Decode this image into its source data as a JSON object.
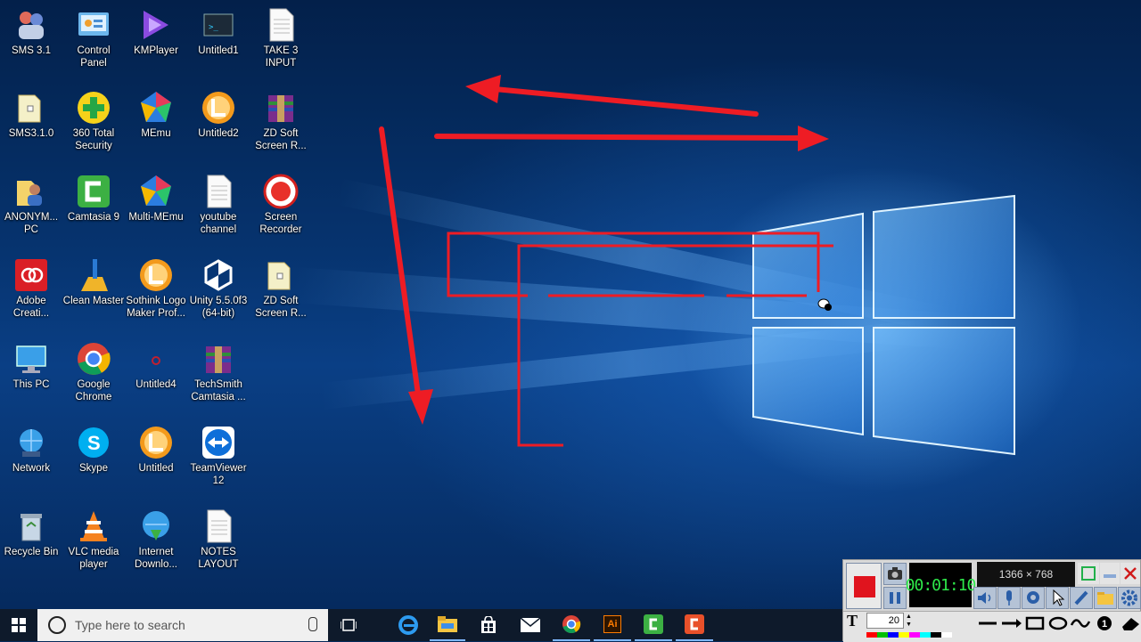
{
  "desktop_icons": [
    {
      "label": "SMS 3.1",
      "icon": "people-icon",
      "col": 0,
      "row": 0
    },
    {
      "label": "Control\nPanel",
      "icon": "control-panel-icon",
      "col": 1,
      "row": 0
    },
    {
      "label": "KMPlayer",
      "icon": "kmplayer-icon",
      "col": 2,
      "row": 0
    },
    {
      "label": "Untitled1",
      "icon": "terminal-icon",
      "col": 3,
      "row": 0
    },
    {
      "label": "TAKE 3\nINPUT",
      "icon": "document-icon",
      "col": 4,
      "row": 0
    },
    {
      "label": "SMS3.1.0",
      "icon": "folder-icon",
      "col": 0,
      "row": 1
    },
    {
      "label": "360 Total\nSecurity",
      "icon": "plus-shield-icon",
      "col": 1,
      "row": 1
    },
    {
      "label": "MEmu",
      "icon": "memu-icon",
      "col": 2,
      "row": 1
    },
    {
      "label": "Untitled2",
      "icon": "sothink-icon",
      "col": 3,
      "row": 1
    },
    {
      "label": "ZD Soft\nScreen R...",
      "icon": "archive-icon",
      "col": 4,
      "row": 1
    },
    {
      "label": "ANONYM...\nPC",
      "icon": "user-folder-icon",
      "col": 0,
      "row": 2
    },
    {
      "label": "Camtasia 9",
      "icon": "camtasia-icon",
      "col": 1,
      "row": 2
    },
    {
      "label": "Multi-MEmu",
      "icon": "memu-icon",
      "col": 2,
      "row": 2
    },
    {
      "label": "youtube\nchannel",
      "icon": "document-icon",
      "col": 3,
      "row": 2
    },
    {
      "label": "Screen\nRecorder",
      "icon": "record-icon",
      "col": 4,
      "row": 2
    },
    {
      "label": "Adobe\nCreati...",
      "icon": "adobe-cc-icon",
      "col": 0,
      "row": 3
    },
    {
      "label": "Clean Master",
      "icon": "broom-icon",
      "col": 1,
      "row": 3
    },
    {
      "label": "Sothink Logo\nMaker Prof...",
      "icon": "sothink-icon",
      "col": 2,
      "row": 3
    },
    {
      "label": "Unity 5.5.0f3\n(64-bit)",
      "icon": "unity-icon",
      "col": 3,
      "row": 3
    },
    {
      "label": "ZD Soft\nScreen R...",
      "icon": "folder-icon",
      "col": 4,
      "row": 3
    },
    {
      "label": "This PC",
      "icon": "monitor-icon",
      "col": 0,
      "row": 4
    },
    {
      "label": "Google\nChrome",
      "icon": "chrome-icon",
      "col": 1,
      "row": 4
    },
    {
      "label": "Untitled4",
      "icon": "small-logo-icon",
      "col": 2,
      "row": 4
    },
    {
      "label": "TechSmith\nCamtasia ...",
      "icon": "archive-icon",
      "col": 3,
      "row": 4
    },
    {
      "label": "Network",
      "icon": "network-icon",
      "col": 0,
      "row": 5
    },
    {
      "label": "Skype",
      "icon": "skype-icon",
      "col": 1,
      "row": 5
    },
    {
      "label": "Untitled",
      "icon": "sothink-icon",
      "col": 2,
      "row": 5
    },
    {
      "label": "TeamViewer\n12",
      "icon": "teamviewer-icon",
      "col": 3,
      "row": 5
    },
    {
      "label": "Recycle Bin",
      "icon": "recycle-bin-icon",
      "col": 0,
      "row": 6
    },
    {
      "label": "VLC media\nplayer",
      "icon": "vlc-icon",
      "col": 1,
      "row": 6
    },
    {
      "label": "Internet\nDownlo...",
      "icon": "idm-icon",
      "col": 2,
      "row": 6
    },
    {
      "label": "NOTES\nLAYOUT",
      "icon": "document-icon",
      "col": 3,
      "row": 6
    }
  ],
  "taskbar": {
    "search_placeholder": "Type here to search",
    "pinned": [
      "task-view-icon",
      "edge-icon",
      "file-explorer-icon",
      "store-icon",
      "mail-icon",
      "chrome-icon",
      "illustrator-icon",
      "camtasia-icon",
      "camtasia-recorder-icon"
    ],
    "illustrator_label": "Ai"
  },
  "recorder": {
    "timer": "00:01:10",
    "resolution": "1366 × 768",
    "font_size": "20",
    "text_tool_label": "T",
    "colors": [
      "#ff0000",
      "#00c000",
      "#0000ff",
      "#ffff00",
      "#ff00ff",
      "#00ffff",
      "#000000",
      "#ffffff"
    ],
    "record_color": "#e0141e"
  },
  "colors": {
    "annotation_red": "#ee1c24"
  }
}
